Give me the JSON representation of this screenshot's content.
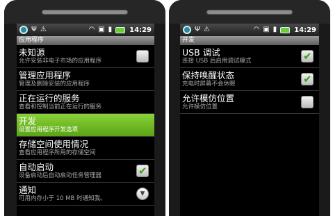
{
  "left": {
    "status": {
      "time": "14:29"
    },
    "title": "应用程序",
    "items": [
      {
        "title": "未知源",
        "sub": "允许安装非电子市场的应用程序",
        "control": "checkbox",
        "checked": false
      },
      {
        "title": "管理应用程序",
        "sub": "管理及删除安装的应用程序"
      },
      {
        "title": "正在运行的服务",
        "sub": "查看和控制当前正在运行的服务"
      },
      {
        "title": "开发",
        "sub": "设置应用程序开发选项",
        "highlighted": true
      },
      {
        "title": "存储空间使用情况",
        "sub": "查看应用程序所用的存储空间"
      },
      {
        "title": "自动启动",
        "sub": "设备启动后自动启动任务管理器",
        "control": "checkbox",
        "checked": true
      },
      {
        "title": "通知",
        "sub": "可用内存小于 10 MB 时通知我。",
        "control": "dropdown"
      }
    ]
  },
  "right": {
    "status": {
      "time": "14:29"
    },
    "title": "开发",
    "items": [
      {
        "title": "USB 调试",
        "sub": "连接 USB 后启用调试模式",
        "control": "checkbox",
        "checked": true
      },
      {
        "title": "保持唤醒状态",
        "sub": "充电时屏幕不会休眠",
        "control": "checkbox",
        "checked": true
      },
      {
        "title": "允许模仿位置",
        "sub": "允许模仿位置",
        "control": "checkbox",
        "checked": false
      }
    ]
  },
  "icons": {
    "status_left": [
      "sync-icon",
      "usb-icon",
      "warning-icon"
    ],
    "status_right": [
      "wifi-icon",
      "sim-icon",
      "signal-icon",
      "battery-icon"
    ],
    "checkbox_check": "check-icon",
    "dropdown": "chevron-down-icon"
  },
  "colors": {
    "highlight": "#6dbb22",
    "check": "#3aa014"
  }
}
